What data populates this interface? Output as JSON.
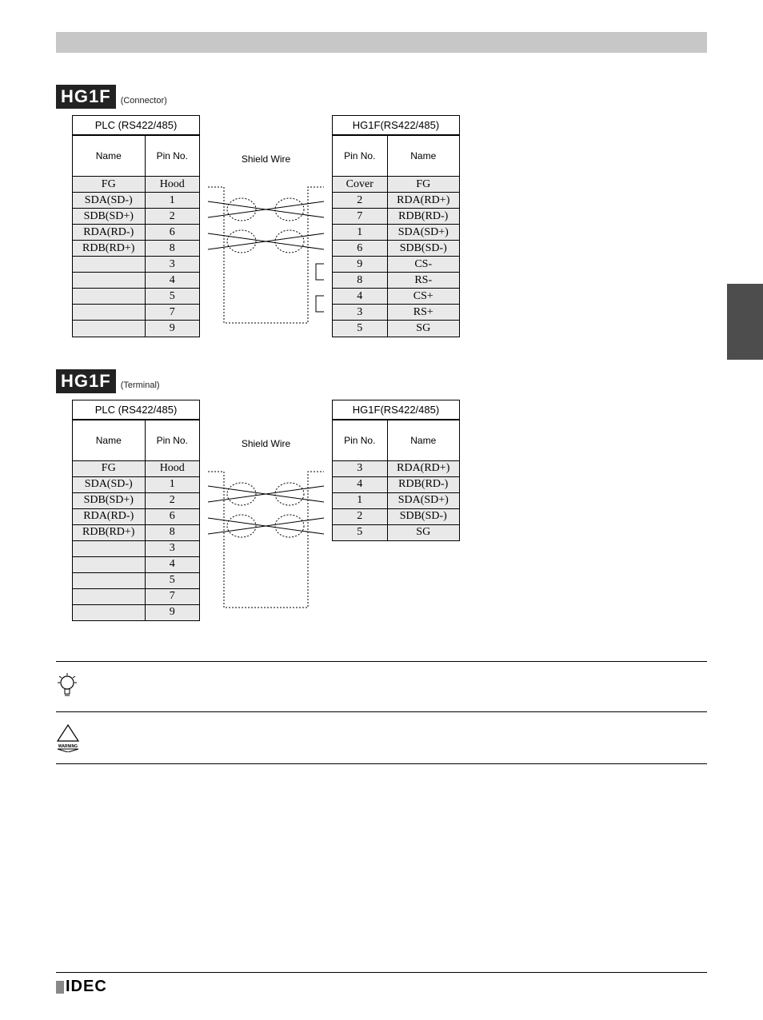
{
  "section1": {
    "badge": "HG1F",
    "note": "(Connector)",
    "left_title": "PLC (RS422/485)",
    "right_title": "HG1F(RS422/485)",
    "mid_label": "Shield Wire",
    "headers_left": [
      "Name",
      "Pin No."
    ],
    "headers_right": [
      "Pin No.",
      "Name"
    ],
    "left_rows": [
      [
        "FG",
        "Hood"
      ],
      [
        "SDA(SD-)",
        "1"
      ],
      [
        "SDB(SD+)",
        "2"
      ],
      [
        "RDA(RD-)",
        "6"
      ],
      [
        "RDB(RD+)",
        "8"
      ],
      [
        "",
        "3"
      ],
      [
        "",
        "4"
      ],
      [
        "",
        "5"
      ],
      [
        "",
        "7"
      ],
      [
        "",
        "9"
      ]
    ],
    "right_rows": [
      [
        "Cover",
        "FG"
      ],
      [
        "2",
        "RDA(RD+)"
      ],
      [
        "7",
        "RDB(RD-)"
      ],
      [
        "1",
        "SDA(SD+)"
      ],
      [
        "6",
        "SDB(SD-)"
      ],
      [
        "9",
        "CS-"
      ],
      [
        "8",
        "RS-"
      ],
      [
        "4",
        "CS+"
      ],
      [
        "3",
        "RS+"
      ],
      [
        "5",
        "SG"
      ]
    ]
  },
  "section2": {
    "badge": "HG1F",
    "note": "(Terminal)",
    "left_title": "PLC (RS422/485)",
    "right_title": "HG1F(RS422/485)",
    "mid_label": "Shield Wire",
    "headers_left": [
      "Name",
      "Pin No."
    ],
    "headers_right": [
      "Pin No.",
      "Name"
    ],
    "left_rows": [
      [
        "FG",
        "Hood"
      ],
      [
        "SDA(SD-)",
        "1"
      ],
      [
        "SDB(SD+)",
        "2"
      ],
      [
        "RDA(RD-)",
        "6"
      ],
      [
        "RDB(RD+)",
        "8"
      ],
      [
        "",
        "3"
      ],
      [
        "",
        "4"
      ],
      [
        "",
        "5"
      ],
      [
        "",
        "7"
      ],
      [
        "",
        "9"
      ]
    ],
    "right_rows": [
      [
        "3",
        "RDA(RD+)"
      ],
      [
        "4",
        "RDB(RD-)"
      ],
      [
        "1",
        "SDA(SD+)"
      ],
      [
        "2",
        "SDB(SD-)"
      ],
      [
        "5",
        "SG"
      ]
    ]
  },
  "footer_brand": "IDEC",
  "warning_label": "WARNING"
}
